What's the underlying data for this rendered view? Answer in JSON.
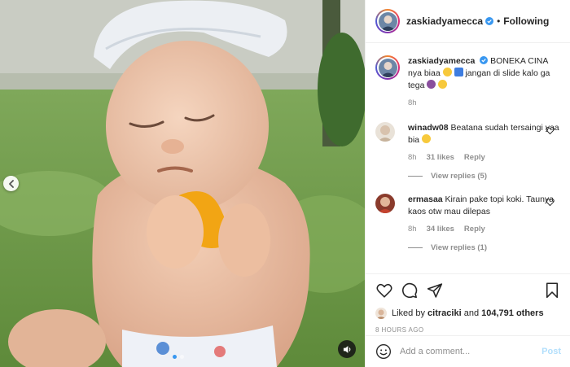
{
  "media": {
    "carousel_total": 2,
    "carousel_active": 0,
    "sound_icon": "speaker-icon",
    "prev_icon": "chevron-left-icon"
  },
  "header": {
    "username": "zaskiadyamecca",
    "separator": "•",
    "follow_label": "Following"
  },
  "caption": {
    "username": "zaskiadyamecca",
    "text_part1": "BONEKA CINA nya biaa",
    "text_part2": "jangan di slide kalo ga tega",
    "time": "8h"
  },
  "comments": [
    {
      "username": "winadw08",
      "text": "Beatana sudah tersaingi yaa bia",
      "time": "8h",
      "likes": "31 likes",
      "reply_label": "Reply",
      "view_replies": "View replies (5)"
    },
    {
      "username": "ermasaa",
      "text": "Kirain pake topi koki. Taunya kaos otw mau dilepas",
      "time": "8h",
      "likes": "34 likes",
      "reply_label": "Reply",
      "view_replies": "View replies (1)"
    }
  ],
  "actions": {
    "liked_by_prefix": "Liked by",
    "liked_by_user": "citraciki",
    "liked_by_and": "and",
    "liked_by_count": "104,791 others",
    "time_ago": "8 HOURS AGO"
  },
  "add_comment": {
    "placeholder": "Add a comment...",
    "post_label": "Post"
  },
  "colors": {
    "accent_blue": "#3897f0",
    "verified_blue": "#3897f0",
    "post_disabled": "#b2dffc",
    "muted_text": "#8e8e8e"
  }
}
